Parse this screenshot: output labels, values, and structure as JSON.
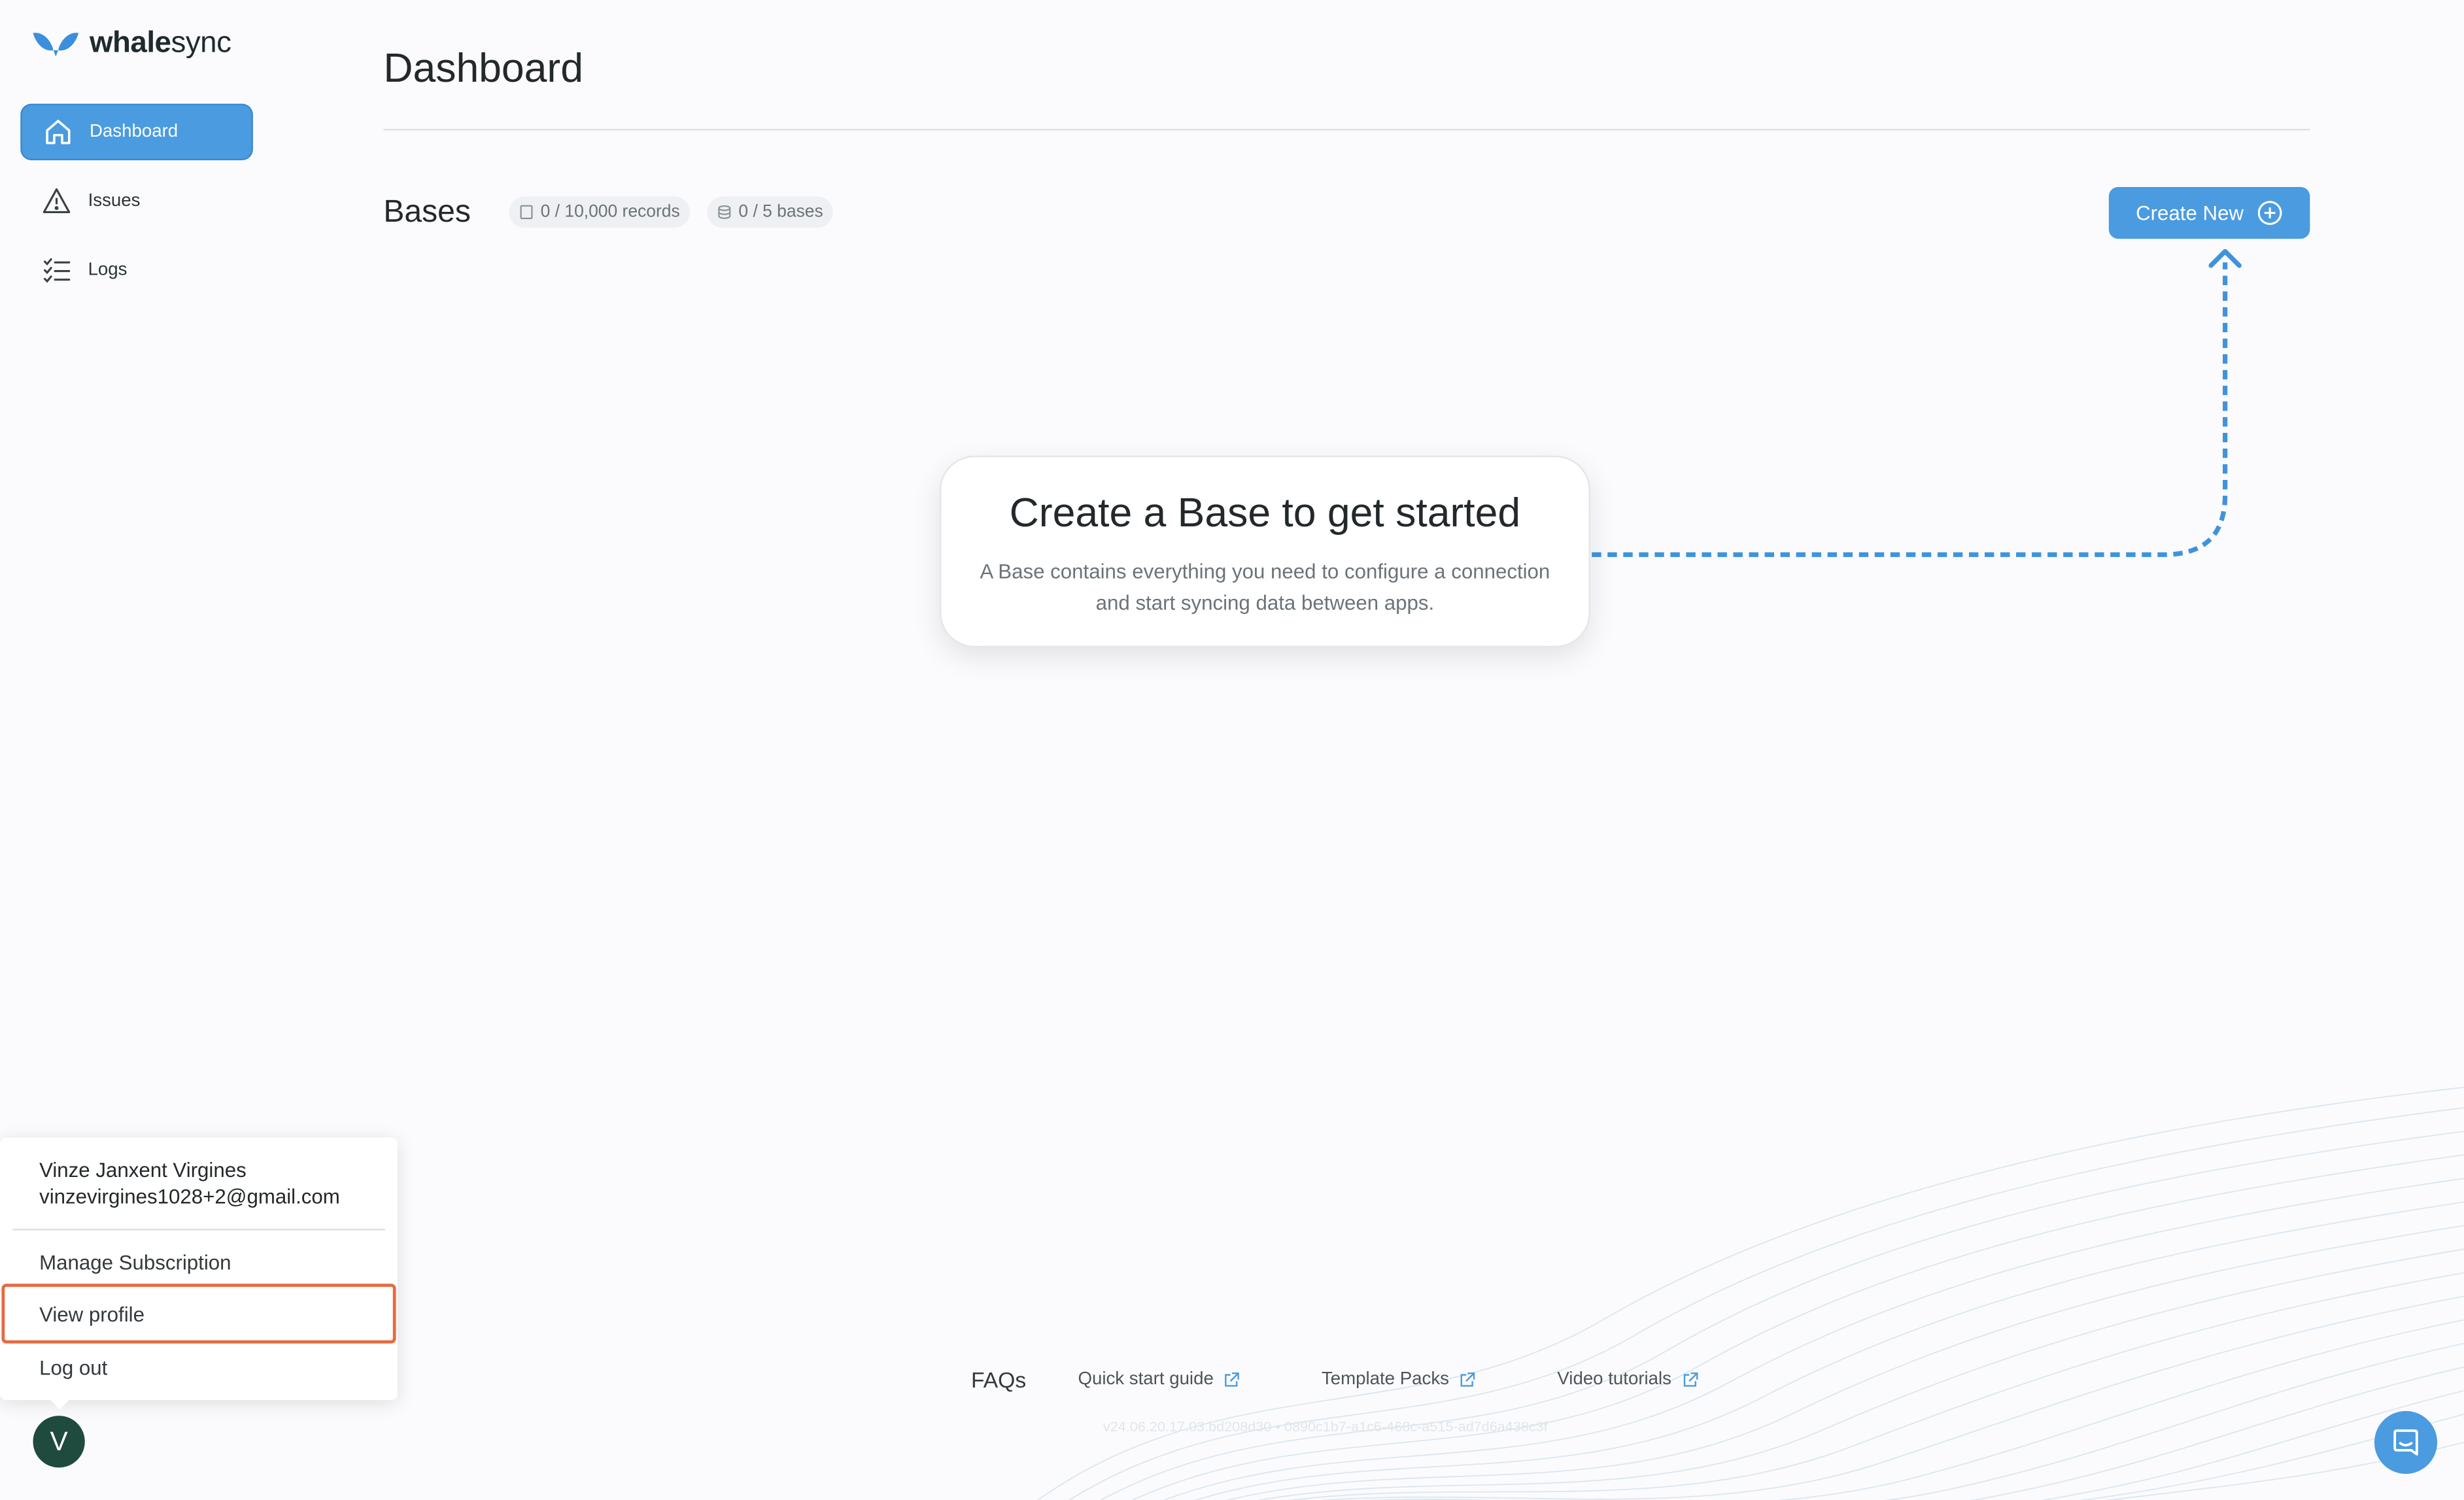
{
  "brand": {
    "name_bold": "whale",
    "name_light": "sync",
    "accent": "#4a9be0"
  },
  "sidebar": {
    "items": [
      {
        "label": "Dashboard",
        "icon": "home-icon",
        "active": true
      },
      {
        "label": "Issues",
        "icon": "warning-icon",
        "active": false
      },
      {
        "label": "Logs",
        "icon": "checklist-icon",
        "active": false
      }
    ]
  },
  "main": {
    "title": "Dashboard",
    "bases": {
      "title": "Bases",
      "records_pill": "0 / 10,000 records",
      "bases_pill": "0 / 5 bases",
      "create_label": "Create New"
    },
    "empty_state": {
      "title": "Create a Base to get started",
      "body": "A Base contains everything you need to configure a connection and start syncing data between apps."
    }
  },
  "footer": {
    "faq_label": "FAQs",
    "links": [
      "Quick start guide",
      "Template Packs",
      "Video tutorials"
    ],
    "version": "v24.06.20.17.03.bd208d30 • 0890c1b7-a1c6-468c-a515-ad7d6a438c3f"
  },
  "user_menu": {
    "name": "Vinze Janxent Virgines",
    "email": "vinzevirgines1028+2@gmail.com",
    "items": [
      "Manage Subscription",
      "View profile",
      "Log out"
    ],
    "highlighted": "View profile",
    "avatar_initial": "V"
  }
}
